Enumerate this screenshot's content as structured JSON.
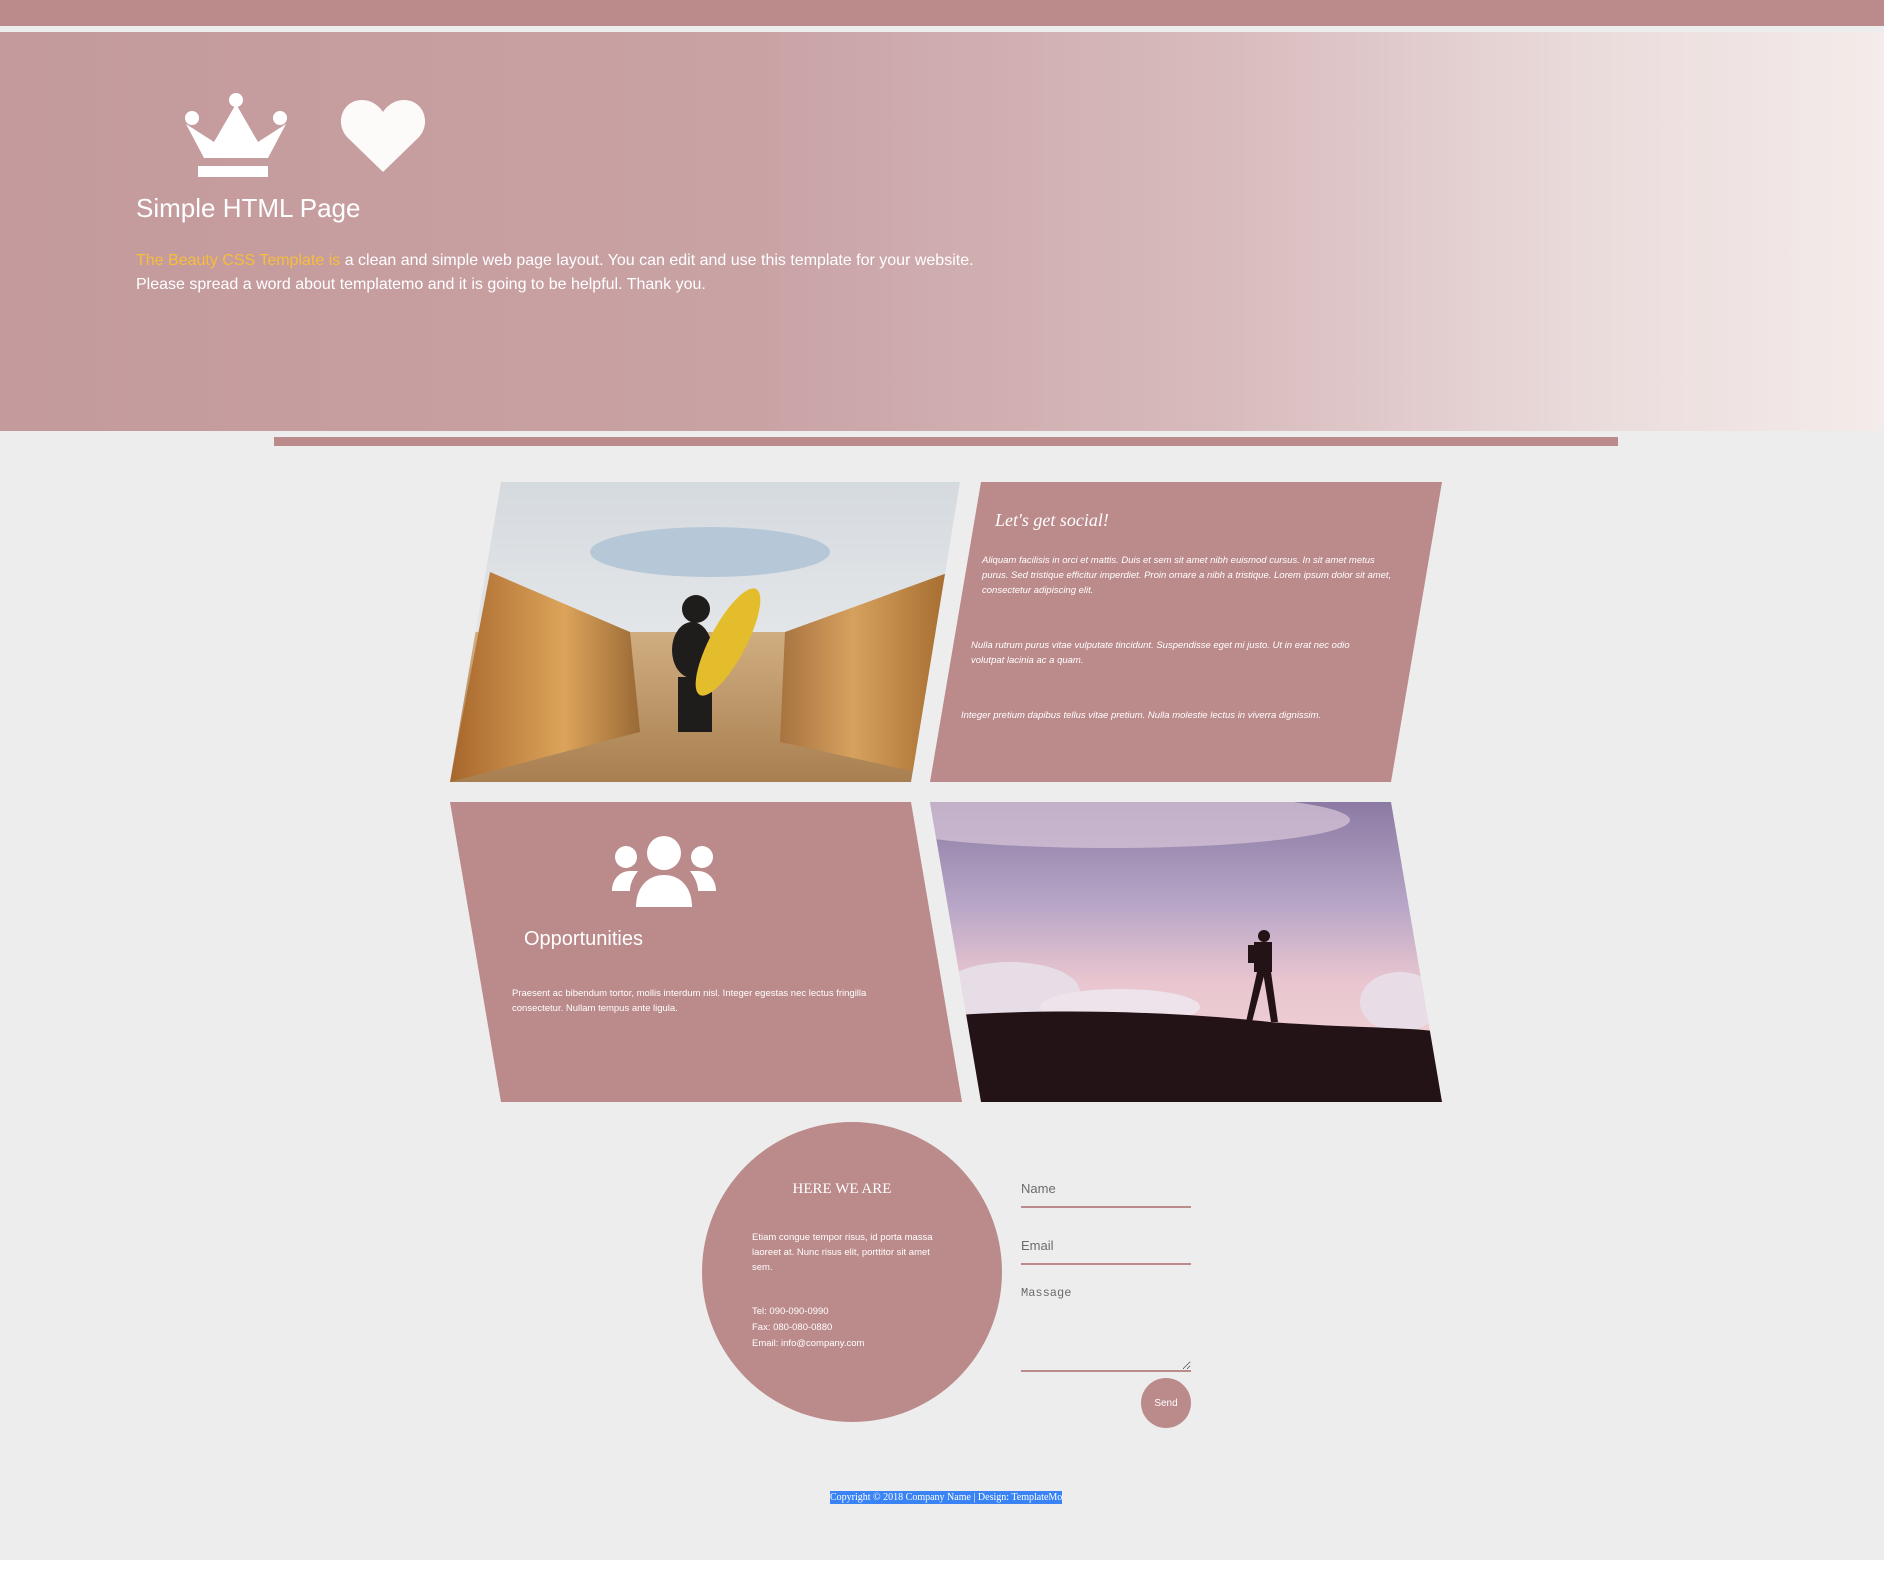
{
  "hero": {
    "title": "Simple HTML Page",
    "highlight": "The Beauty CSS Template is",
    "text_line1": " a clean and simple web page layout. You can edit and use this template for your website.",
    "text_line2": "Please spread a word about templatemo and it is going to be helpful. Thank you.",
    "icons": [
      "crown-icon",
      "heart-icon"
    ]
  },
  "social": {
    "title": "Let's get social!",
    "p1": "Aliquam facilisis in orci et mattis. Duis et sem sit amet nibh euismod cursus. In sit amet metus purus. Sed tristique efficitur imperdiet. Proin ornare a nibh a tristique. Lorem ipsum dolor sit amet, consectetur adipiscing elit.",
    "p2": "Nulla rutrum purus vitae vulputate tincidunt. Suspendisse eget mi justo. Ut in erat nec odio volutpat lacinia ac a quam.",
    "p3": "Integer pretium dapibus tellus vitae pretium. Nulla molestie lectus in viverra dignissim."
  },
  "opportunities": {
    "icon": "people-icon",
    "title": "Opportunities",
    "text": "Praesent ac bibendum tortor, mollis interdum nisl. Integer egestas nec lectus fringilla consectetur. Nullam tempus ante ligula."
  },
  "contact": {
    "title": "HERE WE ARE",
    "text": "Etiam congue tempor risus, id porta massa laoreet at. Nunc risus elit, porttitor sit amet sem.",
    "tel": "Tel: 090-090-0990",
    "fax": "Fax: 080-080-0880",
    "email": "Email: info@company.com"
  },
  "form": {
    "name_placeholder": "Name",
    "email_placeholder": "Email",
    "message_placeholder": "Massage",
    "send_label": "Send"
  },
  "footer": {
    "copyright": "Copyright © 2018 Company Name | Design: TemplateMo"
  },
  "colors": {
    "accent": "#bb8a8b",
    "highlight": "#f7bd3b",
    "background": "#eeeded"
  }
}
